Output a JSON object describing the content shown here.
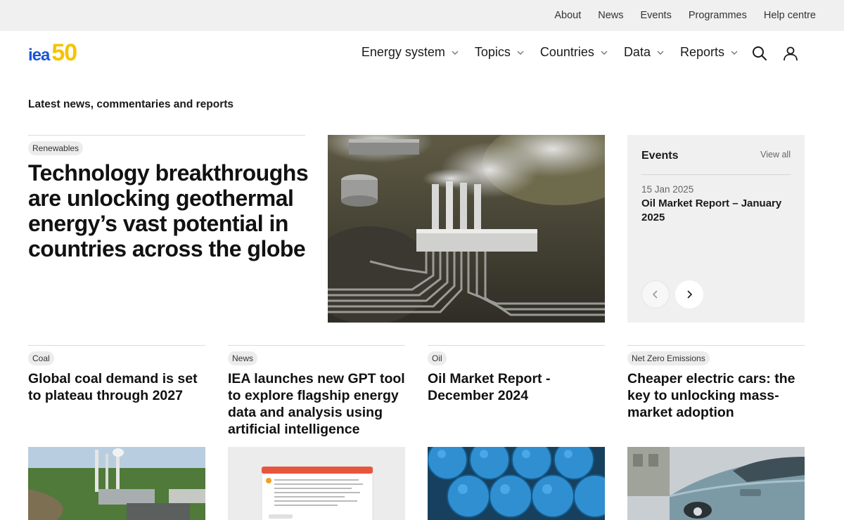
{
  "utility_nav": [
    "About",
    "News",
    "Events",
    "Programmes",
    "Help centre"
  ],
  "logo": {
    "primary": "iea",
    "secondary": "50"
  },
  "main_nav": [
    "Energy system",
    "Topics",
    "Countries",
    "Data",
    "Reports"
  ],
  "section_title": "Latest news, commentaries and reports",
  "feature": {
    "tag": "Renewables",
    "headline": "Technology breakthroughs are unlocking geothermal energy’s vast potential in countries across the globe"
  },
  "events": {
    "title": "Events",
    "view_all": "View all",
    "date": "15 Jan 2025",
    "event_title": "Oil Market Report – January 2025"
  },
  "cards": [
    {
      "tag": "Coal",
      "headline": "Global coal demand is set to plateau through 2027"
    },
    {
      "tag": "News",
      "headline": "IEA launches new GPT tool to explore flagship energy data and analysis using artificial intelligence"
    },
    {
      "tag": "Oil",
      "headline": "Oil Market Report - December 2024"
    },
    {
      "tag": "Net Zero Emissions",
      "headline": "Cheaper electric cars: the key to unlocking mass-market adoption"
    }
  ],
  "colors": {
    "brand_blue": "#1a56d6",
    "brand_yellow": "#f5c400",
    "utility_bg": "#f0f0f0",
    "tag_bg": "#ececec"
  },
  "icons": [
    "chevron-down-icon",
    "search-icon",
    "user-icon",
    "chevron-left-icon",
    "chevron-right-icon"
  ]
}
